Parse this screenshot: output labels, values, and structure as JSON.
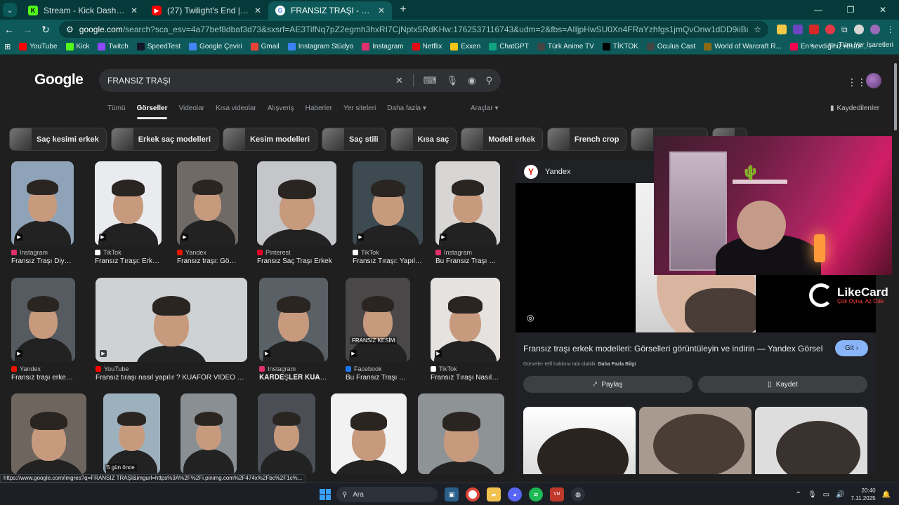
{
  "browser": {
    "tabs": [
      {
        "title": "Stream - Kick Dashboard",
        "favicon": "kick-icon",
        "active": false
      },
      {
        "title": "(27) Twilight's End | 2025 Seas…",
        "favicon": "youtube-icon",
        "active": false
      },
      {
        "title": "FRANSIZ TRAŞI - Google'da Ara",
        "favicon": "google-icon",
        "active": true
      }
    ],
    "url_host": "google.com",
    "url_rest": "/search?sca_esv=4a77bef8dbaf3d73&sxsrf=AE3TifNq7pZ2egmh3hxRI7CjNptx5RdKHw:1762537116743&udm=2&fbs=AIIjpHwSU0Xn4FRaYzhfgs1jmQvOnw1dDD9iiBuIB2fsjeHv6Rzi_t8nCYrA3VAYvcClsvbUFIKuwCY8y74ek...",
    "bookmarks": [
      {
        "label": "YouTube",
        "color": "#ff0000"
      },
      {
        "label": "Kick",
        "color": "#53fc18"
      },
      {
        "label": "Twitch",
        "color": "#9146ff"
      },
      {
        "label": "SpeedTest",
        "color": "#141526"
      },
      {
        "label": "Google Çeviri",
        "color": "#4285f4"
      },
      {
        "label": "Gmail",
        "color": "#ea4335"
      },
      {
        "label": "Instagram Stüdyo",
        "color": "#3b82f6"
      },
      {
        "label": "Instagram",
        "color": "#e1306c"
      },
      {
        "label": "Netflix",
        "color": "#e50914"
      },
      {
        "label": "Exxen",
        "color": "#f5c518"
      },
      {
        "label": "ChatGPT",
        "color": "#10a37f"
      },
      {
        "label": "Türk Anime TV",
        "color": "#444444"
      },
      {
        "label": "TİKTOK",
        "color": "#000000"
      },
      {
        "label": "Oculus Cast",
        "color": "#444444"
      },
      {
        "label": "World of Warcraft R...",
        "color": "#8b6914"
      },
      {
        "label": "En sevdiğiniz restor...",
        "color": "#fa0050"
      }
    ],
    "all_bookmarks_label": "Tüm Yer İşaretleri"
  },
  "google": {
    "logo": "Google",
    "query": "FRANSIZ TRAŞI",
    "nav_tabs": [
      "Tümü",
      "Görseller",
      "Videolar",
      "Kısa videolar",
      "Alışveriş",
      "Haberler",
      "Yer siteleri",
      "Daha fazla"
    ],
    "tools_label": "Araçlar",
    "saved_label": "Kaydedilenler",
    "chips": [
      "Saç kesimi erkek",
      "Erkek saç modelleri",
      "Kesim modelleri",
      "Saç stili",
      "Kısa saç",
      "Modeli erkek",
      "French crop",
      "Fransız saç",
      ""
    ],
    "results": [
      {
        "source": "Instagram",
        "caption": "Fransız Traşı Diyorl...",
        "src_color": "#e1306c"
      },
      {
        "source": "TikTok",
        "caption": "Fransız Tıraşı: Erke...",
        "src_color": "#ffffff"
      },
      {
        "source": "Yandex",
        "caption": "Fransız traşı: Görsel...",
        "src_color": "#e61400"
      },
      {
        "source": "Pinterest",
        "caption": "Fransız Saç Traşı Erkek",
        "src_color": "#e60023"
      },
      {
        "source": "TikTok",
        "caption": "Fransız Tıraşı: Yapılı...",
        "src_color": "#ffffff"
      },
      {
        "source": "Instagram",
        "caption": "Bu Fransız Traşı Fra...",
        "src_color": "#e1306c"
      },
      {
        "source": "Yandex",
        "caption": "Fransız traşı erkek: ...",
        "src_color": "#e61400"
      },
      {
        "source": "YouTube",
        "caption": "Fransız tıraşı nasıl yapılır ? KUAFÖR VİDEO BE...",
        "src_color": "#ff0000"
      },
      {
        "source": "Instagram",
        "caption": "𝐊𝐀𝐑𝐃𝐄Ş𝐋𝐄𝐑 𝐊𝐔𝐀𝐅Ö...",
        "src_color": "#e1306c"
      },
      {
        "source": "Facebook",
        "caption": "Bu Fransız Traşı Fra...",
        "src_color": "#1877f2"
      },
      {
        "source": "TikTok",
        "caption": "Fransız Tıraşı Nasıl Y...",
        "src_color": "#ffffff"
      }
    ],
    "overlays": {
      "kesim": "FRANSIZ KESİM",
      "ago": "5 gün önce"
    },
    "preview": {
      "source": "Yandex",
      "title": "Fransız traşı erkek modelleri: Görselleri görüntüleyin ve indirin — Yandex Görsel",
      "visit_label": "Git",
      "copyright": "Görseller telif hakkına tabi olabilir.",
      "learn_more": "Daha Fazla Bilgi",
      "share_label": "Paylaş",
      "save_label": "Kaydet"
    },
    "status_url": "https://www.google.com/imgres?q=FRANSIZ TRAŞI&imgurl=https%3A%2F%2Fi.pinimg.com%2F474x%2Fbc%2F1c%..."
  },
  "overlay": {
    "brand": "LikeCard",
    "tagline": "Çok Oyna, Az Öde"
  },
  "taskbar": {
    "search_label": "Ara",
    "time": "20:40",
    "date": "7.11.2025",
    "badge": "99+"
  }
}
